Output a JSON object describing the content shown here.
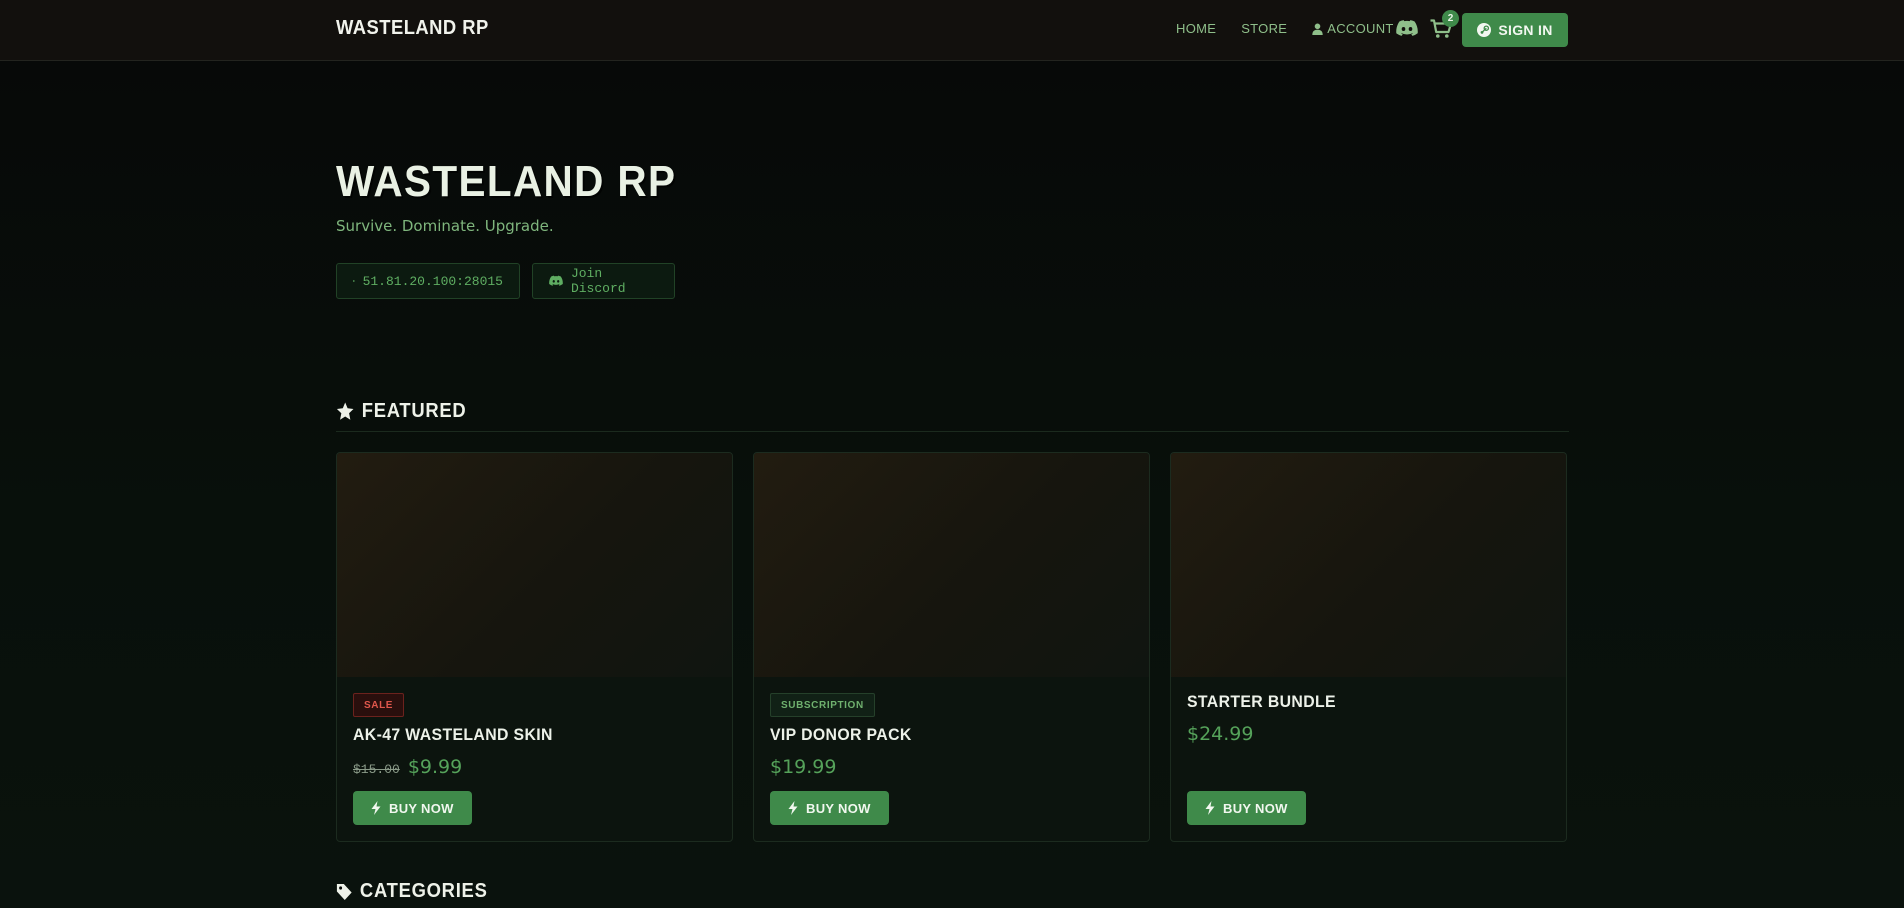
{
  "nav": {
    "brand": "WASTELAND RP",
    "links": {
      "home": "HOME",
      "store": "STORE",
      "account": "ACCOUNT"
    },
    "cart_count": "2",
    "sign_in": "SIGN IN"
  },
  "hero": {
    "title": "WASTELAND RP",
    "subtitle": "Survive. Dominate. Upgrade.",
    "server_ip": "51.81.20.100:28015",
    "discord_label": "Join Discord"
  },
  "featured": {
    "heading": "FEATURED",
    "items": [
      {
        "badge": "SALE",
        "name": "AK-47 WASTELAND SKIN",
        "old_price": "$15.00",
        "price": "$9.99",
        "button": "BUY NOW"
      },
      {
        "badge": "SUBSCRIPTION",
        "name": "VIP DONOR PACK",
        "price": "$19.99",
        "button": "BUY NOW"
      },
      {
        "name": "STARTER BUNDLE",
        "price": "$24.99",
        "button": "BUY NOW"
      }
    ]
  },
  "categories": {
    "heading": "CATEGORIES"
  },
  "icons": {
    "discord": "discord-icon",
    "cart": "cart-icon",
    "steam": "steam-icon",
    "server": "server-icon",
    "star": "star-icon",
    "bolt": "bolt-icon",
    "tag": "tag-icon",
    "user": "user-icon"
  },
  "colors": {
    "accent": "#3f8a4a",
    "price": "#55a25a",
    "sale": "#e0574c",
    "background": "#070908"
  }
}
